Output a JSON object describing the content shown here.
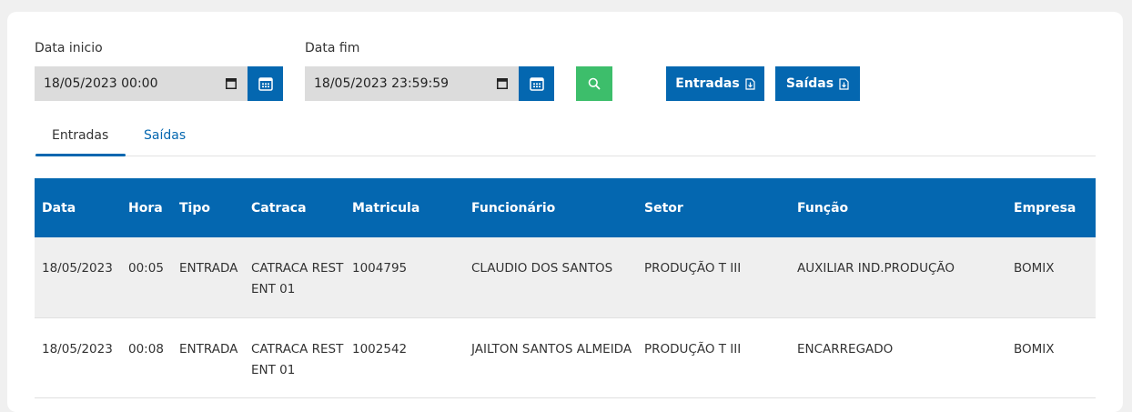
{
  "filters": {
    "start_label": "Data inicio",
    "start_value": "18/05/2023 00:00",
    "end_label": "Data fim",
    "end_value": "18/05/2023 23:59:59",
    "calendar_icon": "calendar-icon",
    "search_icon": "search-icon"
  },
  "actions": {
    "entradas_label": "Entradas",
    "saidas_label": "Saídas",
    "export_icon": "file-download-icon"
  },
  "tabs": [
    {
      "label": "Entradas",
      "active": true
    },
    {
      "label": "Saídas",
      "active": false
    }
  ],
  "table": {
    "headers": [
      "Data",
      "Hora",
      "Tipo",
      "Catraca",
      "Matricula",
      "Funcionário",
      "Setor",
      "Função",
      "Empresa"
    ],
    "rows": [
      [
        "18/05/2023",
        "00:05",
        "ENTRADA",
        "CATRACA REST ENT 01",
        "1004795",
        "CLAUDIO DOS SANTOS",
        "PRODUÇÃO T III",
        "AUXILIAR IND.PRODUÇÃO",
        "BOMIX"
      ],
      [
        "18/05/2023",
        "00:08",
        "ENTRADA",
        "CATRACA REST ENT 01",
        "1002542",
        "JAILTON SANTOS ALMEIDA",
        "PRODUÇÃO T III",
        "ENCARREGADO",
        "BOMIX"
      ]
    ]
  },
  "colors": {
    "primary": "#0467b0",
    "search": "#3dbe6b",
    "input_bg": "#dcdcdc",
    "row_alt": "#efefef"
  }
}
